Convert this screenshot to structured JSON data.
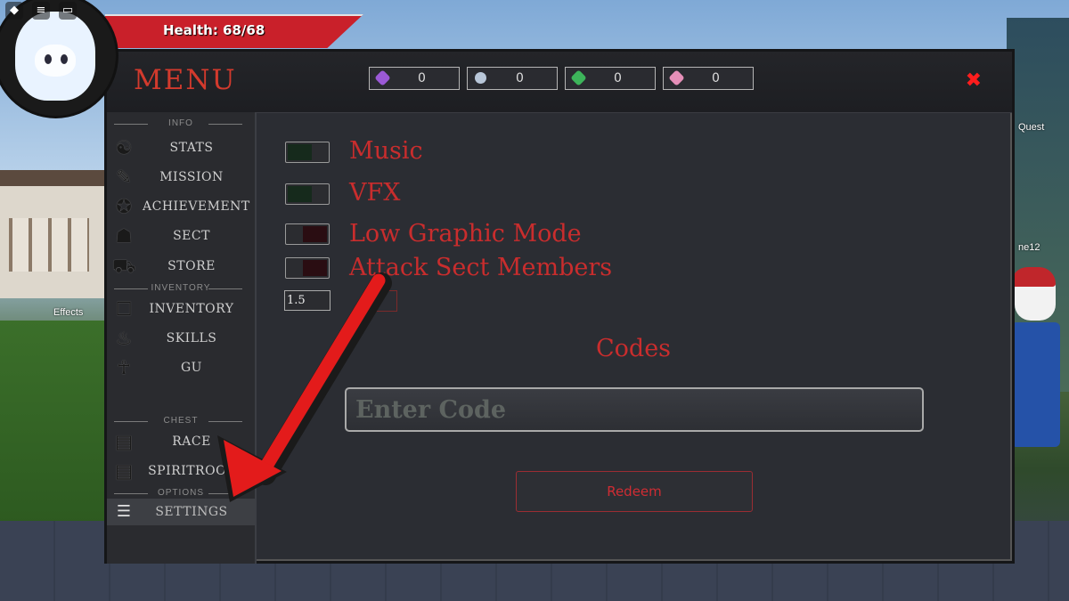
{
  "hud": {
    "health_label": "Health: 68/68",
    "icons": [
      "roblox-menu-icon",
      "hamburger-icon",
      "chat-icon"
    ]
  },
  "background": {
    "effects_label": "Effects",
    "quest_label": "Quest",
    "player_label": "ne12"
  },
  "menu": {
    "title": "MENU",
    "close_symbol": "✖",
    "currencies": [
      {
        "icon": "purple-gem-icon",
        "color": "#9b59d6",
        "value": "0"
      },
      {
        "icon": "silver-ore-icon",
        "color": "#b8c6d8",
        "value": "0"
      },
      {
        "icon": "green-crystal-icon",
        "color": "#3db45a",
        "value": "0"
      },
      {
        "icon": "pink-crystal-icon",
        "color": "#e58fb8",
        "value": "0"
      }
    ]
  },
  "sidebar": {
    "sections": {
      "info": "INFO",
      "inventory": "INVENTORY",
      "chest": "CHEST",
      "options": "OPTIONS"
    },
    "items": [
      {
        "label": "STATS",
        "icon": "stats-icon",
        "glyph": "☯"
      },
      {
        "label": "MISSION",
        "icon": "scroll-icon",
        "glyph": "✎"
      },
      {
        "label": "ACHIEVEMENT",
        "icon": "medal-icon",
        "glyph": "✪"
      },
      {
        "label": "SECT",
        "icon": "group-icon",
        "glyph": "☗"
      },
      {
        "label": "STORE",
        "icon": "cart-icon",
        "glyph": "⛟"
      },
      {
        "label": "INVENTORY",
        "icon": "backpack-icon",
        "glyph": "☐"
      },
      {
        "label": "SKILLS",
        "icon": "flame-icon",
        "glyph": "♨"
      },
      {
        "label": "GU",
        "icon": "insect-icon",
        "glyph": "☥"
      },
      {
        "label": "RACE",
        "icon": "chest-icon",
        "glyph": "▤"
      },
      {
        "label": "SPIRITROOT",
        "icon": "chest-icon",
        "glyph": "▤"
      },
      {
        "label": "SETTINGS",
        "icon": "sliders-icon",
        "glyph": "☰"
      }
    ]
  },
  "settings": {
    "music_label": "Music",
    "vfx_label": "VFX",
    "low_graphic_label": "Low Graphic Mode",
    "attack_sect_label": "Attack Sect Members",
    "number_value": "1.5",
    "toggles": {
      "music": true,
      "vfx": true,
      "low_graphic": false,
      "attack_sect": false
    }
  },
  "codes": {
    "title": "Codes",
    "placeholder": "Enter Code",
    "redeem_label": "Redeem"
  },
  "colors": {
    "accent_red": "#c92d2d",
    "panel_bg": "#2b2d33",
    "arrow": "#e31b1b"
  }
}
